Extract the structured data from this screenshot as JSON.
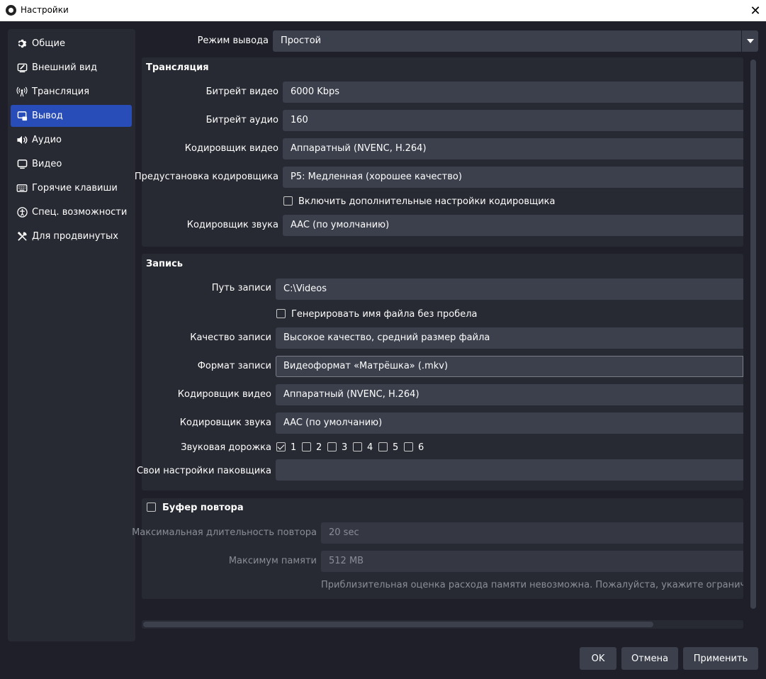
{
  "window": {
    "title": "Настройки",
    "close": "✕"
  },
  "sidebar": {
    "items": [
      {
        "label": "Общие",
        "icon": "gear-icon"
      },
      {
        "label": "Внешний вид",
        "icon": "appearance-icon"
      },
      {
        "label": "Трансляция",
        "icon": "broadcast-icon"
      },
      {
        "label": "Вывод",
        "icon": "output-icon",
        "active": true
      },
      {
        "label": "Аудио",
        "icon": "speaker-icon"
      },
      {
        "label": "Видео",
        "icon": "monitor-icon"
      },
      {
        "label": "Горячие клавиши",
        "icon": "keyboard-icon"
      },
      {
        "label": "Спец. возможности",
        "icon": "accessibility-icon"
      },
      {
        "label": "Для продвинутых",
        "icon": "tools-icon"
      }
    ]
  },
  "output_mode": {
    "label": "Режим вывода",
    "value": "Простой"
  },
  "streaming": {
    "title": "Трансляция",
    "video_bitrate": {
      "label": "Битрейт видео",
      "value": "6000 Kbps"
    },
    "audio_bitrate": {
      "label": "Битрейт аудио",
      "value": "160"
    },
    "video_encoder": {
      "label": "Кодировщик видео",
      "value": "Аппаратный (NVENC, H.264)"
    },
    "encoder_preset": {
      "label": "Предустановка кодировщика",
      "value": "P5: Медленная (хорошее качество)"
    },
    "advanced_encoder": {
      "label": "Включить дополнительные настройки кодировщика",
      "checked": false
    },
    "audio_encoder": {
      "label": "Кодировщик звука",
      "value": "AAC (по умолчанию)"
    }
  },
  "recording": {
    "title": "Запись",
    "path": {
      "label": "Путь записи",
      "value": "C:\\Videos"
    },
    "no_space": {
      "label": "Генерировать имя файла без пробела",
      "checked": false
    },
    "quality": {
      "label": "Качество записи",
      "value": "Высокое качество, средний размер файла"
    },
    "format": {
      "label": "Формат записи",
      "value": "Видеоформат «Матрёшка» (.mkv)"
    },
    "video_encoder": {
      "label": "Кодировщик видео",
      "value": "Аппаратный (NVENC, H.264)"
    },
    "audio_encoder": {
      "label": "Кодировщик звука",
      "value": "AAC (по умолчанию)"
    },
    "audio_track": {
      "label": "Звуковая дорожка",
      "tracks": [
        {
          "label": "1",
          "checked": true
        },
        {
          "label": "2",
          "checked": false
        },
        {
          "label": "3",
          "checked": false
        },
        {
          "label": "4",
          "checked": false
        },
        {
          "label": "5",
          "checked": false
        },
        {
          "label": "6",
          "checked": false
        }
      ]
    },
    "muxer": {
      "label": "Свои настройки паковщика",
      "value": ""
    }
  },
  "replay_buffer": {
    "title": "Буфер повтора",
    "checked": false,
    "max_duration": {
      "label": "Максимальная длительность повтора",
      "value": "20 sec"
    },
    "max_memory": {
      "label": "Максимум памяти",
      "value": "512 MB"
    },
    "note": "Приблизительная оценка расхода памяти невозможна. Пожалуйста, укажите ограничение расх"
  },
  "buttons": {
    "ok": "OK",
    "cancel": "Отмена",
    "apply": "Применить"
  }
}
